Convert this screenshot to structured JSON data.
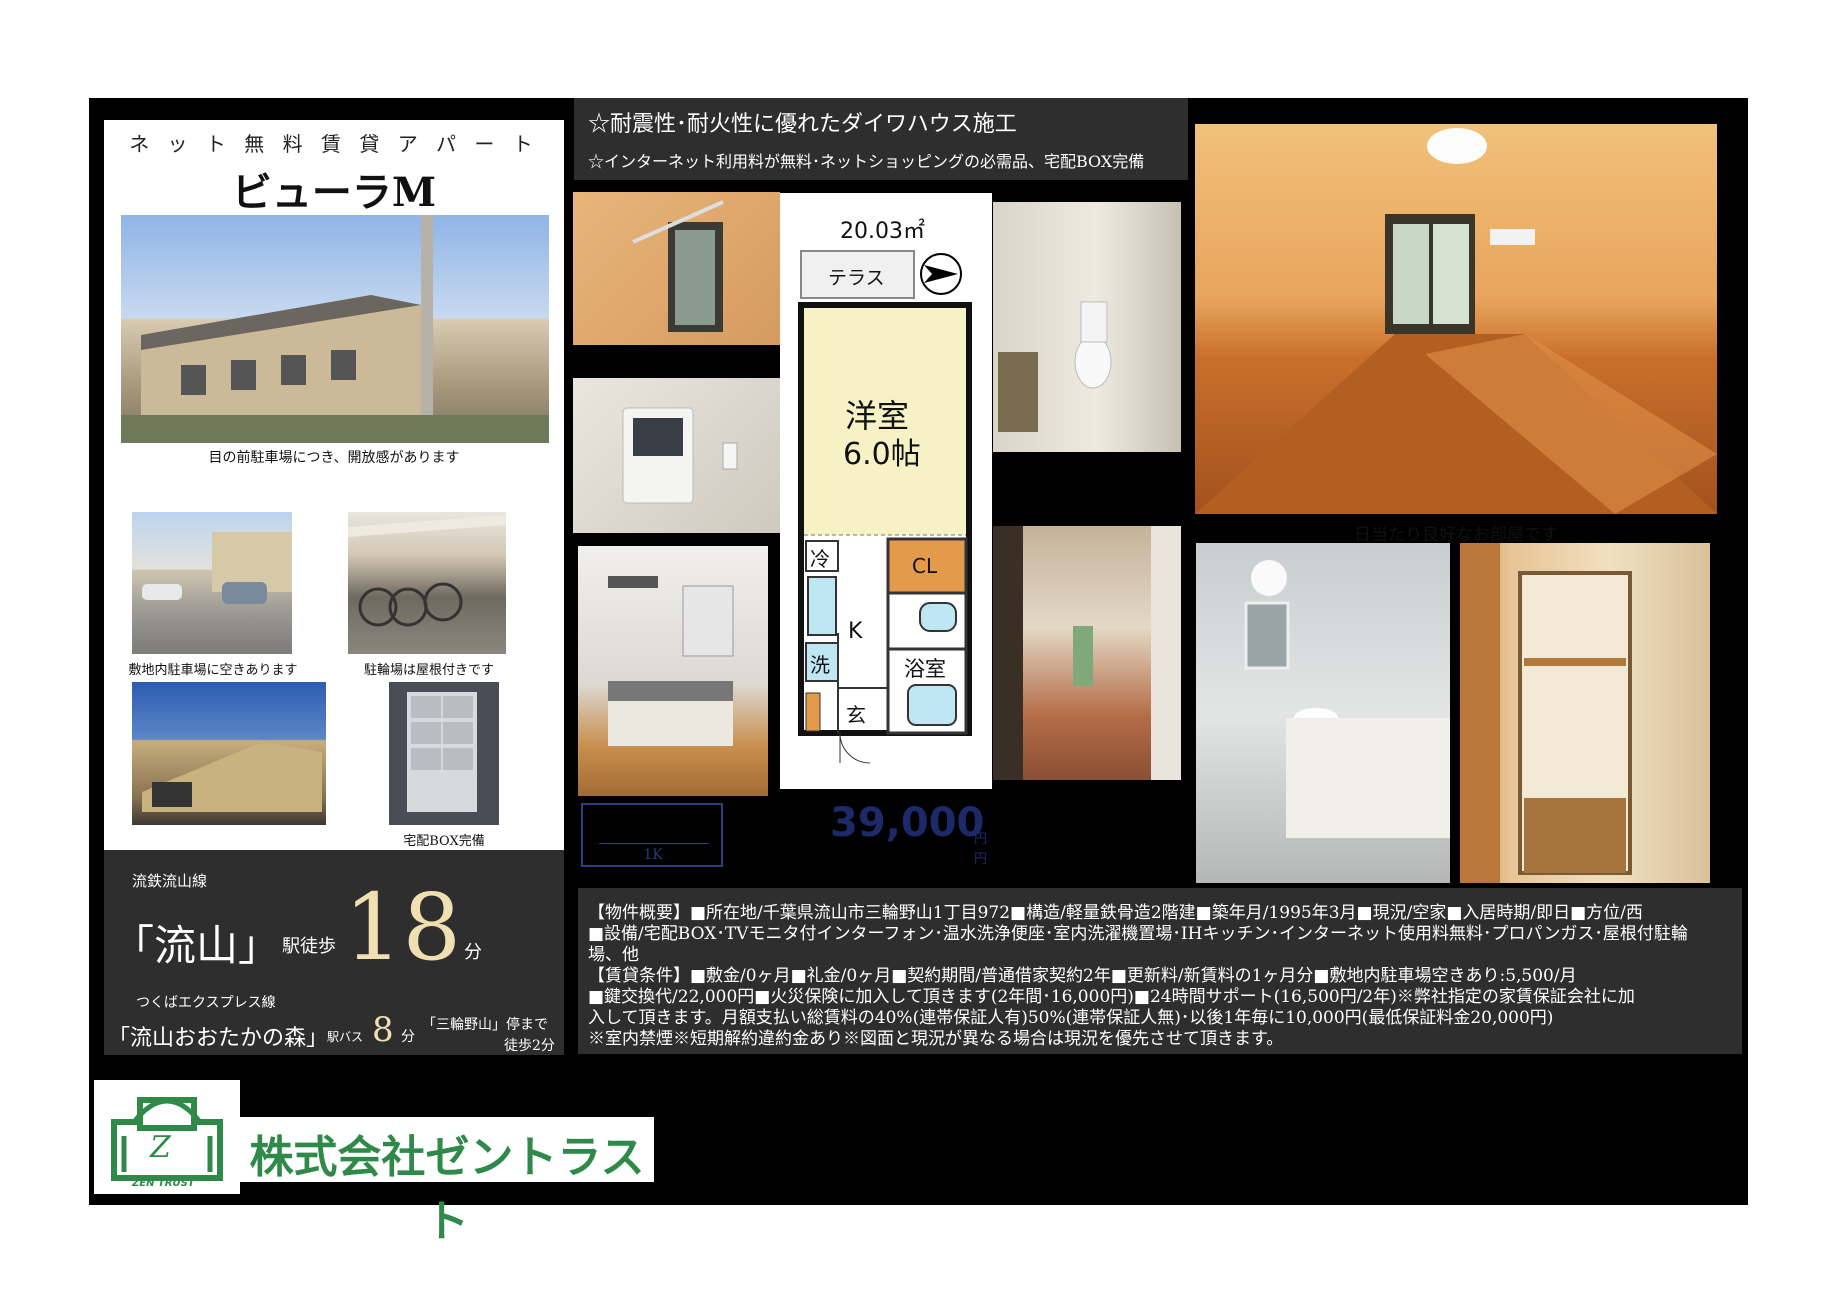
{
  "left_panel": {
    "tagline": "ネ ッ ト 無 料 賃 貸 ア パ ー ト",
    "name": "ビューラM",
    "captions": {
      "main_photo": "目の前駐車場につき、開放感があります",
      "parking": "敷地内駐車場に空きあります",
      "bicycle": "駐輪場は屋根付きです",
      "delivery_box": "宅配BOX完備"
    }
  },
  "access": {
    "line1": "流鉄流山線",
    "station1": "「流山」",
    "walk_label": "駅徒歩",
    "walk_minutes": "18",
    "minute_unit": "分",
    "line2": "つくばエクスプレス線",
    "station2": "「流山おおたかの森」",
    "bus_label": "駅バス",
    "bus_minutes": "8",
    "bus_unit": "分",
    "bus_stop": "「三輪野山」停まで",
    "bus_walk": "徒歩2分"
  },
  "headlines": {
    "main": "☆耐震性･耐火性に優れたダイワハウス施工",
    "sub": "☆インターネット利用料が無料･ネットショッピングの必需品、宅配BOX完備"
  },
  "floorplan": {
    "area": "20.03㎡",
    "terrace": "テラス",
    "room": "洋室",
    "room_size": "6.0帖",
    "fridge": "冷",
    "closet": "CL",
    "kitchen": "K",
    "laundry": "洗",
    "bath": "浴室",
    "entrance": "玄"
  },
  "layout_type": "1K",
  "rent": {
    "amount": "39,000",
    "unit": "円"
  },
  "photo_caption_main": "日当たり良好なお部屋です",
  "details": {
    "lines": [
      "【物件概要】■所在地/千葉県流山市三輪野山1丁目972■構造/軽量鉄骨造2階建■築年月/1995年3月■現況/空家■入居時期/即日■方位/西",
      "■設備/宅配BOX･TVモニタ付インターフォン･温水洗浄便座･室内洗濯機置場･IHキッチン･インターネット使用料無料･プロパンガス･屋根付駐輪",
      "場、他",
      "【賃貸条件】■敷金/0ヶ月■礼金/0ヶ月■契約期間/普通借家契約2年■更新料/新賃料の1ヶ月分■敷地内駐車場空きあり:5,500/月",
      "■鍵交換代/22,000円■火災保険に加入して頂きます(2年間･16,000円)■24時間サポート(16,500円/2年)※弊社指定の家賃保証会社に加",
      "入して頂きます。月額支払い総賃料の40%(連帯保証人有)50%(連帯保証人無)･以後1年毎に10,000円(最低保証料金20,000円)",
      "※室内禁煙※短期解約違約金あり※図面と現況が異なる場合は現況を優先させて頂きます。"
    ]
  },
  "company": {
    "name": "株式会社ゼントラスト",
    "logo_text": "ZEN TRUST",
    "logo_letter": "Z"
  },
  "colors": {
    "sheet": "#000000",
    "panel": "#2e2e2e",
    "closet_fill": "#e39a4a",
    "room_fill": "#f6f2c6",
    "rent_text": "#1c2a6a",
    "logo_green": "#2f8a4a"
  }
}
